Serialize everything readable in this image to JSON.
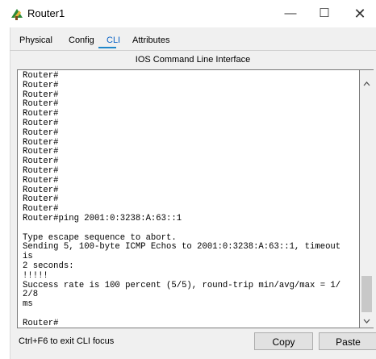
{
  "window": {
    "title": "Router1",
    "minimize_glyph": "—",
    "maximize_glyph": "☐",
    "close_glyph": "✕"
  },
  "tabs": [
    {
      "label": "Physical",
      "active": false
    },
    {
      "label": "Config",
      "active": false
    },
    {
      "label": "CLI",
      "active": true
    },
    {
      "label": "Attributes",
      "active": false
    }
  ],
  "panel": {
    "title": "IOS Command Line Interface"
  },
  "terminal": {
    "lines": [
      "Router#",
      "Router#",
      "Router#",
      "Router#",
      "Router#",
      "Router#",
      "Router#",
      "Router#",
      "Router#",
      "Router#",
      "Router#",
      "Router#",
      "Router#",
      "Router#",
      "Router#",
      "Router#ping 2001:0:3238:A:63::1",
      "",
      "Type escape sequence to abort.",
      "Sending 5, 100-byte ICMP Echos to 2001:0:3238:A:63::1, timeout is",
      "2 seconds:",
      "!!!!!",
      "Success rate is 100 percent (5/5), round-trip min/avg/max = 1/2/8",
      "ms",
      "",
      "Router#"
    ]
  },
  "footer": {
    "hint": "Ctrl+F6 to exit CLI focus",
    "copy_label": "Copy",
    "paste_label": "Paste"
  },
  "icons": {
    "app": "router-icon",
    "scroll_up": "chevron-up-icon",
    "scroll_down": "chevron-down-icon"
  },
  "colors": {
    "active_tab": "#0a62c5",
    "tab_underline": "#1f86c9"
  }
}
